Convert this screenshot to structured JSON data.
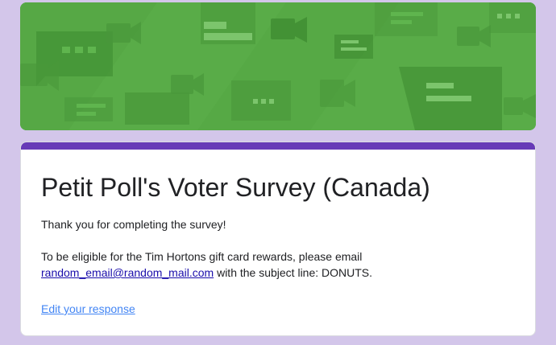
{
  "banner": {
    "theme": "chat-bubbles-and-video-icons",
    "colors": {
      "background": "#59ac48",
      "shape": "#49973a",
      "shape_light": "#5fb54e",
      "highlight": "#7cc56c"
    }
  },
  "form": {
    "accent_color": "#673ab7",
    "title": "Petit Poll's Voter Survey (Canada)",
    "confirmation_line1": "Thank you for completing the survey!",
    "confirmation_line2_before": "To be eligible for the Tim Hortons gift card rewards, please email",
    "email": "random_email@random_mail.com",
    "confirmation_line2_after": " with the subject line: DONUTS.",
    "edit_link": "Edit your response"
  }
}
